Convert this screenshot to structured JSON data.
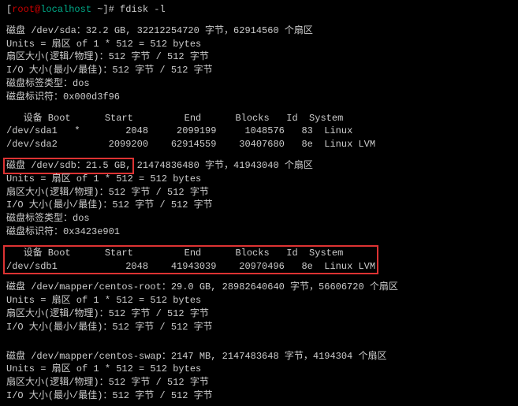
{
  "prompt": {
    "open": "[",
    "user": "root",
    "at": "@",
    "host": "localhost",
    "path": " ~]# ",
    "command": "fdisk -l"
  },
  "sda": {
    "header": "磁盘 /dev/sda：32.2 GB, 32212254720 字节，62914560 个扇区",
    "units": "Units = 扇区 of 1 * 512 = 512 bytes",
    "sector": "扇区大小(逻辑/物理)：512 字节 / 512 字节",
    "io": "I/O 大小(最小/最佳)：512 字节 / 512 字节",
    "labeltype": "磁盘标签类型：dos",
    "identifier": "磁盘标识符：0x000d3f96",
    "cols": "   设备 Boot      Start         End      Blocks   Id  System",
    "row1": "/dev/sda1   *        2048     2099199     1048576   83  Linux",
    "row2": "/dev/sda2         2099200    62914559    30407680   8e  Linux LVM"
  },
  "sdb": {
    "header_boxed": "磁盘 /dev/sdb：21.5 GB,",
    "header_rest": " 21474836480 字节，41943040 个扇区",
    "units": "Units = 扇区 of 1 * 512 = 512 bytes",
    "sector": "扇区大小(逻辑/物理)：512 字节 / 512 字节",
    "io": "I/O 大小(最小/最佳)：512 字节 / 512 字节",
    "labeltype": "磁盘标签类型：dos",
    "identifier": "磁盘标识符：0x3423e901",
    "cols": "   设备 Boot      Start         End      Blocks   Id  System",
    "row1": "/dev/sdb1            2048    41943039    20970496   8e  Linux LVM"
  },
  "mapper_root": {
    "header": "磁盘 /dev/mapper/centos-root：29.0 GB, 28982640640 字节，56606720 个扇区",
    "units": "Units = 扇区 of 1 * 512 = 512 bytes",
    "sector": "扇区大小(逻辑/物理)：512 字节 / 512 字节",
    "io": "I/O 大小(最小/最佳)：512 字节 / 512 字节"
  },
  "mapper_swap": {
    "header": "磁盘 /dev/mapper/centos-swap：2147 MB, 2147483648 字节，4194304 个扇区",
    "units": "Units = 扇区 of 1 * 512 = 512 bytes",
    "sector": "扇区大小(逻辑/物理)：512 字节 / 512 字节",
    "io": "I/O 大小(最小/最佳)：512 字节 / 512 字节"
  }
}
